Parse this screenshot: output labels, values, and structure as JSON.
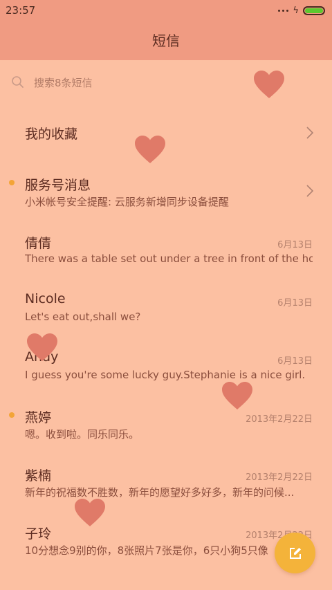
{
  "status_bar": {
    "time": "23:57"
  },
  "header": {
    "title": "短信"
  },
  "search": {
    "placeholder": "搜索8条短信"
  },
  "favorites": {
    "label": "我的收藏"
  },
  "service": {
    "name": "服务号消息",
    "preview": "小米帐号安全提醒: 云服务新增同步设备提醒"
  },
  "conversations": [
    {
      "name": "倩倩",
      "preview": "There was a table set out under a tree in front of the ho...",
      "date": "6月13日"
    },
    {
      "name": "Nicole",
      "preview": "Let's eat out,shall we?",
      "date": "6月13日"
    },
    {
      "name": "Andy",
      "preview": "I guess you're some lucky guy.Stephanie is a nice girl.",
      "date": "6月13日"
    },
    {
      "name": "燕婷",
      "preview": "嗯。收到啦。同乐同乐。",
      "date": "2013年2月22日"
    },
    {
      "name": "紫楠",
      "preview": "新年的祝福数不胜数，新年的愿望好多好多，新年的问候...",
      "date": "2013年2月22日"
    },
    {
      "name": "子玲",
      "preview": "10分想念9别的你，8张照片7张是你，6只小狗5只像",
      "date": "2013年2月22日"
    }
  ],
  "colors": {
    "background": "#fcc0a2",
    "header": "#f09b82",
    "accent": "#f4b33a",
    "heart": "#e07a68",
    "unread": "#f3a437"
  },
  "icons": {
    "search": "search-icon",
    "compose": "compose-icon",
    "chevron": "chevron-right-icon",
    "decoration": "heart-icon"
  }
}
